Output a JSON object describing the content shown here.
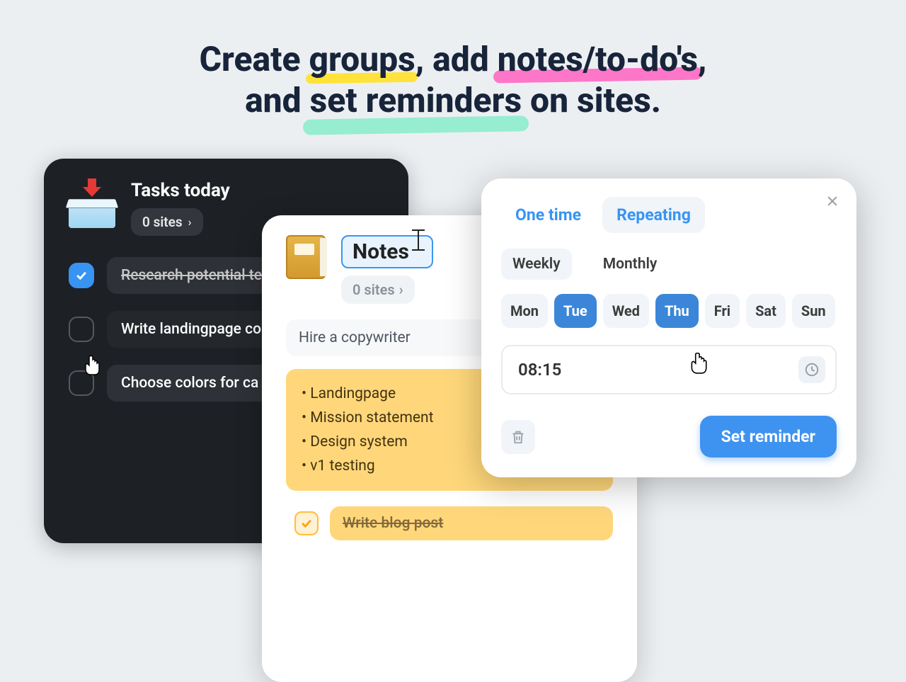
{
  "heading": {
    "line1_pre": "Create ",
    "line1_groups": "groups",
    "line1_mid": ", add ",
    "line1_notes": "notes/to-do's",
    "line1_post": ",",
    "line2_pre": "and ",
    "line2_set": "set reminders",
    "line2_post": " on sites."
  },
  "tasks": {
    "title": "Tasks today",
    "sites_pill": "0 sites",
    "items": [
      {
        "label": "Research potential te",
        "done": true
      },
      {
        "label": "Write landingpage co",
        "done": false
      },
      {
        "label": "Choose colors for ca",
        "done": false
      }
    ]
  },
  "notes": {
    "title": "Notes",
    "sites_pill": "0 sites",
    "hire": "Hire a copywriter",
    "bullets": [
      "Landingpage",
      "Mission statement",
      "Design system",
      "v1 testing"
    ],
    "subtask": "Write blog post"
  },
  "reminder": {
    "tabs": {
      "one": "One time",
      "rep": "Repeating"
    },
    "seg": {
      "weekly": "Weekly",
      "monthly": "Monthly"
    },
    "days": {
      "mon": "Mon",
      "tue": "Tue",
      "wed": "Wed",
      "thu": "Thu",
      "fri": "Fri",
      "sat": "Sat",
      "sun": "Sun"
    },
    "time": "08:15",
    "button": "Set reminder"
  }
}
